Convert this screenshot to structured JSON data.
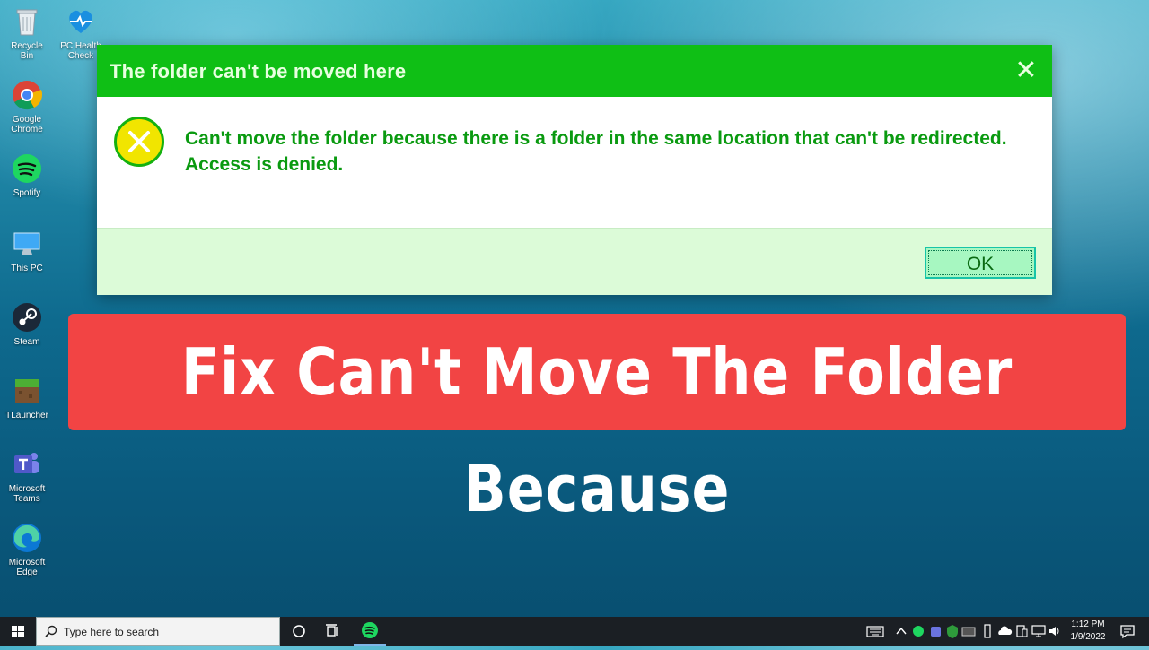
{
  "desktop": {
    "icons": [
      {
        "label": "Recycle Bin"
      },
      {
        "label": "PC Health Check"
      },
      {
        "label": "Google Chrome"
      },
      {
        "label": "Spotify"
      },
      {
        "label": "This PC"
      },
      {
        "label": "Steam"
      },
      {
        "label": "TLauncher"
      },
      {
        "label": "Microsoft Teams"
      },
      {
        "label": "Microsoft Edge"
      }
    ]
  },
  "dialog": {
    "title": "The folder can't be moved here",
    "message_line1": "Can't move the folder because there is a folder in the same location that can't be redirected.",
    "message_line2": "Access is denied.",
    "ok_label": "OK",
    "close_icon": "close-icon",
    "titlebar_color": "#0fbf15",
    "text_color": "#0a9a10"
  },
  "banner": {
    "text": "Fix Can't Move The Folder Because",
    "color": "#f24444"
  },
  "taskbar": {
    "search_placeholder": "Type here to search",
    "time": "1:12 PM",
    "date": "1/9/2022"
  }
}
